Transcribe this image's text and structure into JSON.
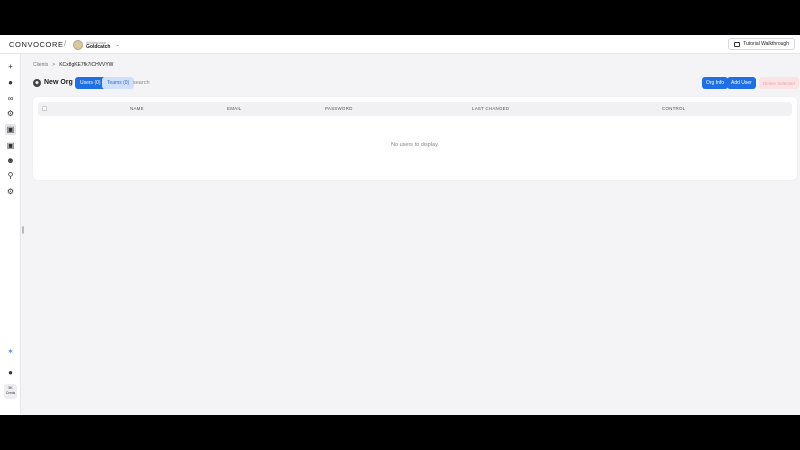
{
  "topbar": {
    "logo": "CONVOCORE",
    "separator": "/",
    "workspace_label": "Workspace",
    "workspace_name": "Goldcatch",
    "tutorial_label": "Tutorial Walkthrough"
  },
  "sidebar": {
    "icons": [
      "plus-icon",
      "circle-icon",
      "link-icon",
      "gear-icon",
      "contacts-icon",
      "lock-icon",
      "users-icon",
      "key-icon",
      "settings-icon",
      "sparkle-icon",
      "profile-icon"
    ],
    "credits_value": "5K",
    "credits_label": "Creds"
  },
  "breadcrumb": {
    "parent": "Clients",
    "separator": ">",
    "current": "KCx8gKE7fk7iCHVVYW"
  },
  "header": {
    "org_title": "New Org",
    "tab_users": "Users (0)",
    "tab_teams": "Teams (0)",
    "search_placeholder": "search",
    "btn_org_info": "Org Info",
    "btn_add_user": "Add User",
    "btn_delete": "Delete Selected"
  },
  "table": {
    "columns": [
      "NAME",
      "EMAIL",
      "PASSWORD",
      "LAST CHANGED",
      "CONTROL"
    ],
    "rows": [],
    "empty_message": "No users to display."
  },
  "colors": {
    "accent": "#1f6fe5",
    "accent_soft": "#cfe0fb",
    "danger_soft": "#fbe3e3",
    "background": "#f4f4f6"
  }
}
